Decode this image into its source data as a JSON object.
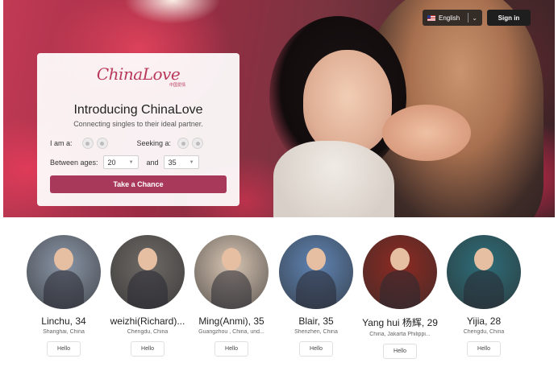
{
  "nav": {
    "language": "English",
    "signin": "Sign in"
  },
  "card": {
    "logo": "ChinaLove",
    "logo_sub": "中国爱情",
    "title": "Introducing ChinaLove",
    "tagline": "Connecting singles to their ideal partner.",
    "i_am_label": "I am a:",
    "seeking_label": "Seeking a:",
    "between_label": "Between ages:",
    "age_min": "20",
    "and_label": "and",
    "age_max": "35",
    "cta": "Take a Chance"
  },
  "profiles": [
    {
      "name": "Linchu, 34",
      "location": "Shanghai, China",
      "hello": "Hello",
      "photo_color": "#8a96a8"
    },
    {
      "name": "weizhi(Richard)...",
      "location": "Chengdu, China",
      "hello": "Hello",
      "photo_color": "#6e6a66"
    },
    {
      "name": "Ming(Anmi), 35",
      "location": "Guangzhou , China, und...",
      "hello": "Hello",
      "photo_color": "#d9c6b4"
    },
    {
      "name": "Blair, 35",
      "location": "Shenzhen, China",
      "hello": "Hello",
      "photo_color": "#5f84b4"
    },
    {
      "name": "Yang hui 杨辉, 29",
      "location": "China, Jakarta Philippi...",
      "hello": "Hello",
      "photo_color": "#8e2a22"
    },
    {
      "name": "Yijia, 28",
      "location": "Chengdu, China",
      "hello": "Hello",
      "photo_color": "#2e6e7a"
    }
  ]
}
